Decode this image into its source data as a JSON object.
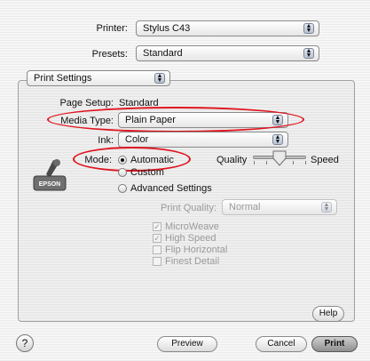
{
  "printer": {
    "label": "Printer:",
    "value": "Stylus C43"
  },
  "presets": {
    "label": "Presets:",
    "value": "Standard"
  },
  "pane": {
    "value": "Print Settings"
  },
  "page_setup": {
    "label": "Page Setup:",
    "value": "Standard"
  },
  "media_type": {
    "label": "Media Type:",
    "value": "Plain Paper"
  },
  "ink": {
    "label": "Ink:",
    "value": "Color"
  },
  "mode": {
    "label": "Mode:",
    "options": [
      "Automatic",
      "Custom",
      "Advanced Settings"
    ],
    "selected": "Automatic"
  },
  "slider": {
    "left_label": "Quality",
    "right_label": "Speed",
    "ticks": 5
  },
  "print_quality": {
    "label": "Print Quality:",
    "value": "Normal",
    "disabled": true
  },
  "checkboxes": [
    {
      "label": "MicroWeave",
      "checked": true,
      "disabled": true
    },
    {
      "label": "High Speed",
      "checked": true,
      "disabled": true
    },
    {
      "label": "Flip Horizontal",
      "checked": false,
      "disabled": true
    },
    {
      "label": "Finest Detail",
      "checked": false,
      "disabled": true
    }
  ],
  "logo": {
    "text": "EPSON"
  },
  "buttons": {
    "help": "Help",
    "preview": "Preview",
    "cancel": "Cancel",
    "print": "Print",
    "help_icon": "?"
  },
  "colors": {
    "highlight": "#e0141f"
  }
}
